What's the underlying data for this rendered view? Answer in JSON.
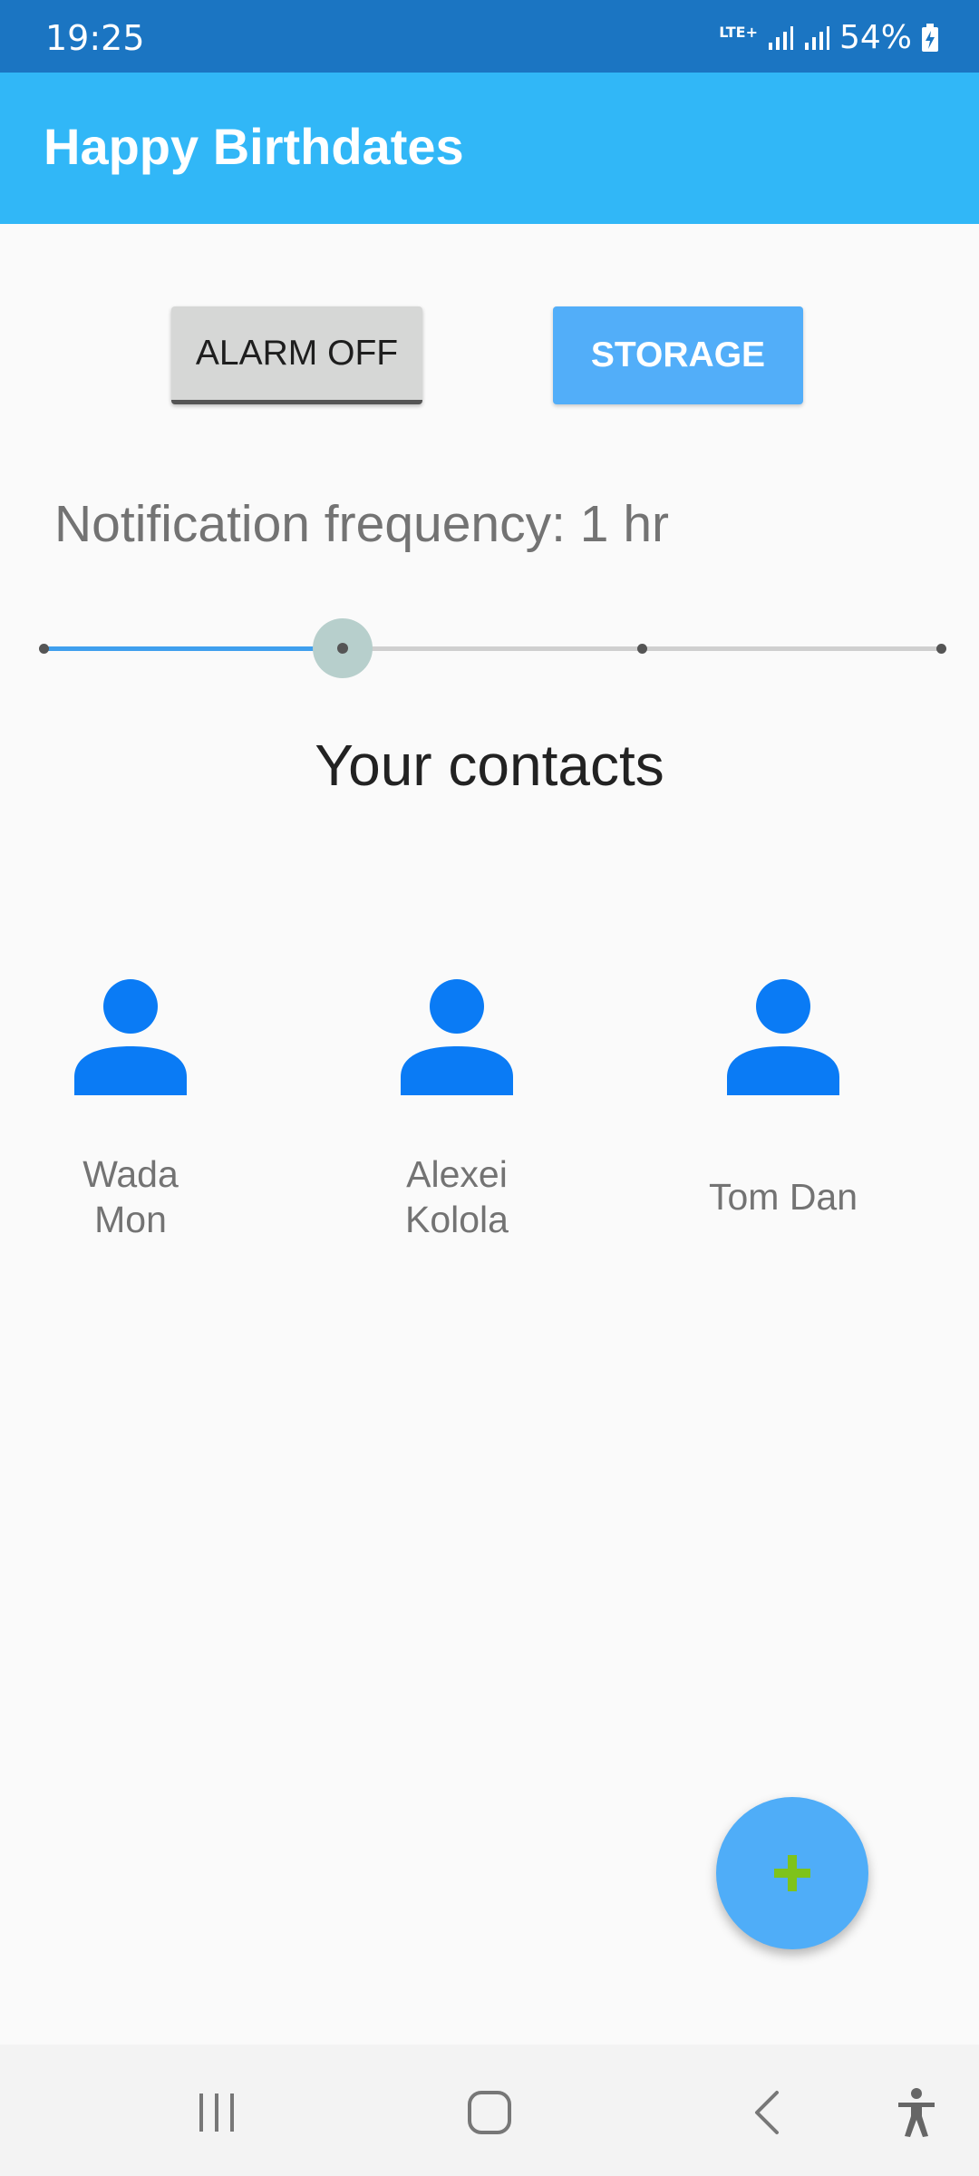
{
  "status_bar": {
    "time": "19:25",
    "network": "LTE+",
    "battery": "54%"
  },
  "app_bar": {
    "title": "Happy Birthdates"
  },
  "buttons": {
    "alarm_label": "ALARM OFF",
    "storage_label": "STORAGE"
  },
  "notification": {
    "label": "Notification frequency: 1 hr",
    "slider_stops": 4,
    "slider_selected_index": 1
  },
  "contacts": {
    "title": "Your contacts",
    "items": [
      {
        "name": "Wada Mon",
        "icon": "person-icon"
      },
      {
        "name": "Alexei Kolola",
        "icon": "person-icon"
      },
      {
        "name": "Tom Dan",
        "icon": "person-icon"
      }
    ]
  },
  "fab": {
    "icon": "plus-icon"
  },
  "navigation": {
    "recents": "recents-icon",
    "home": "home-icon",
    "back": "back-icon",
    "accessibility": "accessibility-icon"
  },
  "colors": {
    "status_bar": "#1b75c2",
    "app_bar": "#31b7f7",
    "accent": "#52aef9",
    "person_icon": "#0a7bf5",
    "fab_plus": "#7ec31b"
  }
}
